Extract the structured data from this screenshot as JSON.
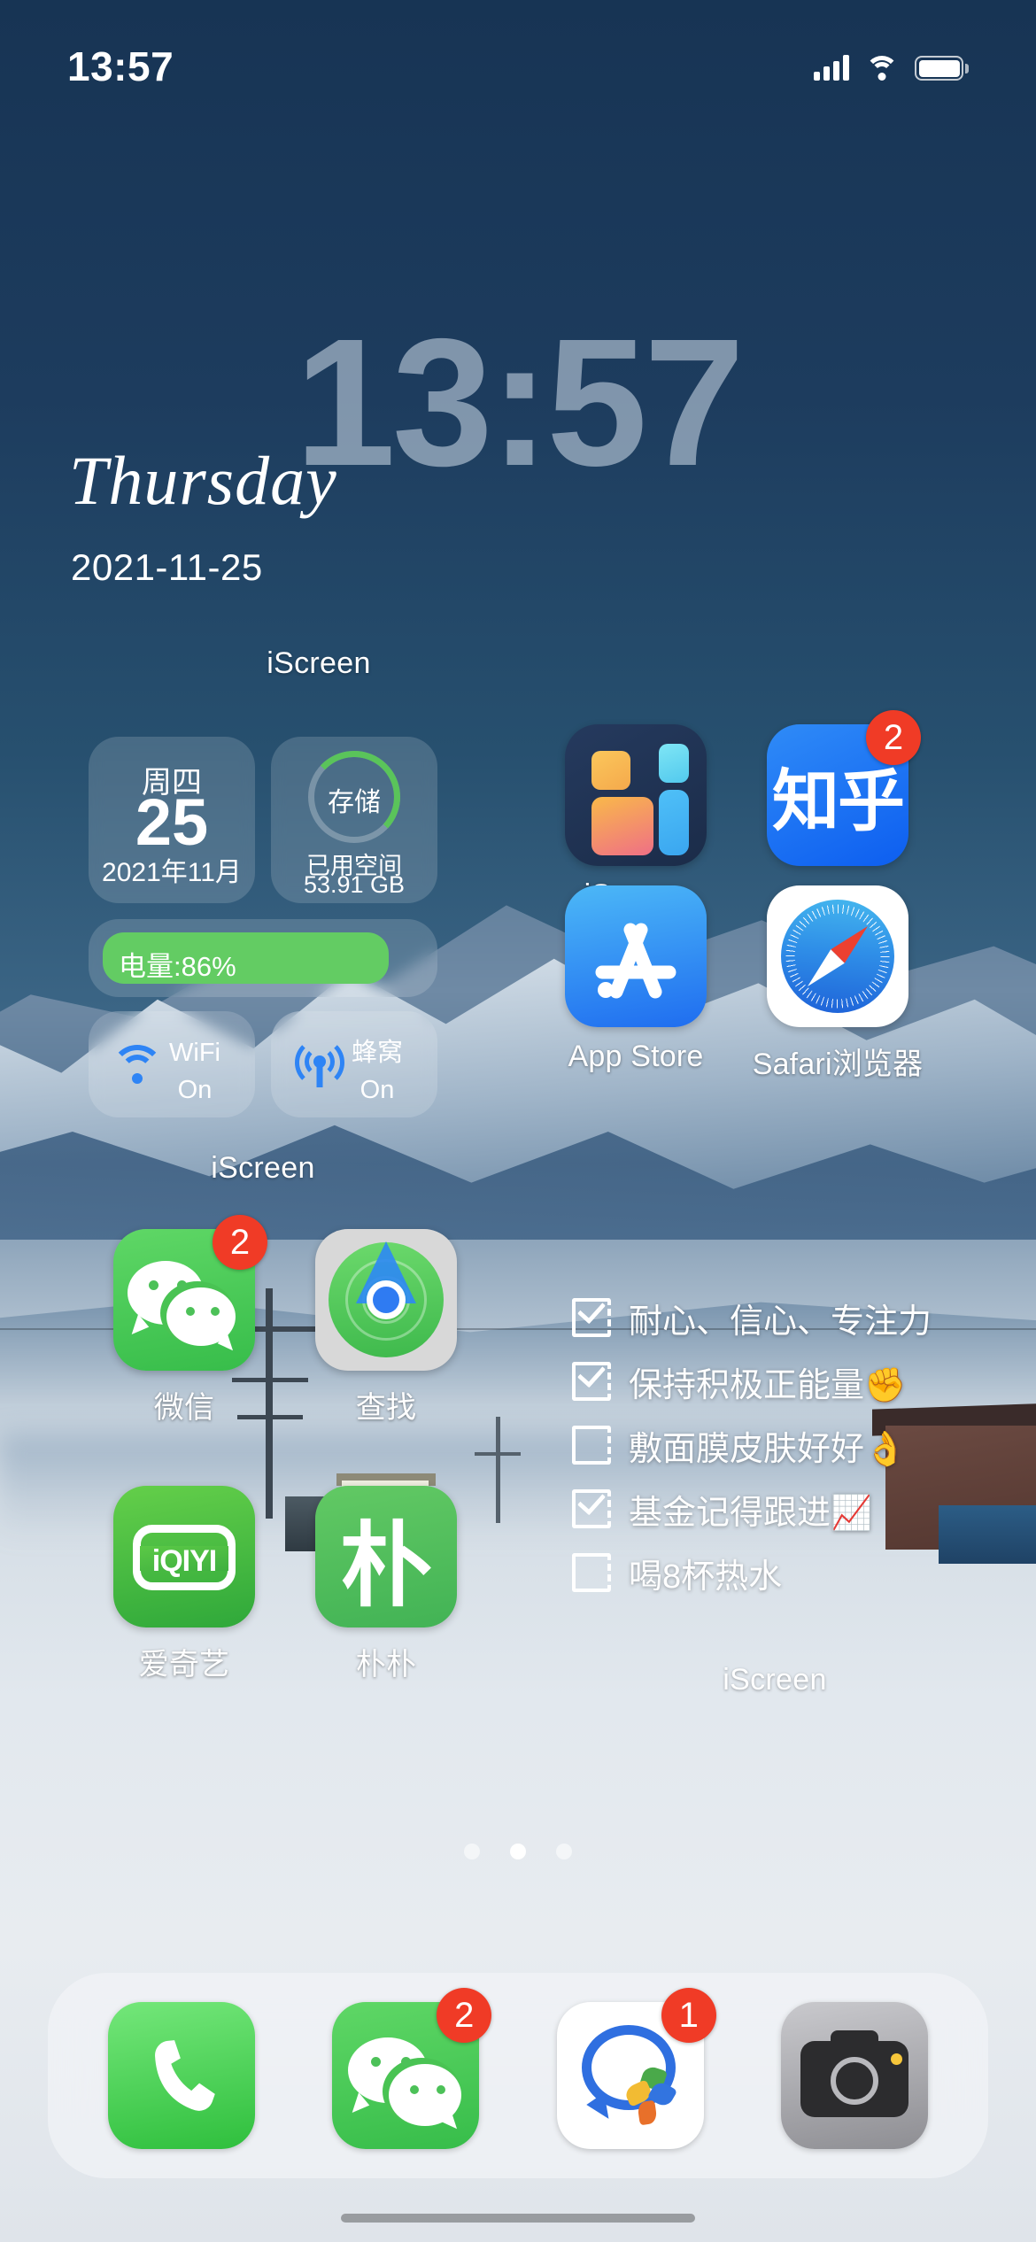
{
  "status_bar": {
    "time": "13:57",
    "cellular_icon": "signal-bars-icon",
    "wifi_icon": "wifi-icon",
    "battery_icon": "battery-icon"
  },
  "clock_widget": {
    "time": "13:57",
    "weekday": "Thursday",
    "date": "2021-11-25"
  },
  "widget_titles": {
    "top": "iScreen",
    "left": "iScreen",
    "checklist": "iScreen"
  },
  "widgets": {
    "date_card": {
      "weekday_cn": "周四",
      "day": "25",
      "year_month": "2021年11月"
    },
    "storage_card": {
      "ring_label": "存储",
      "used_label": "已用空间",
      "used_value": "53.91 GB",
      "ring_color": "#5ac45a",
      "ring_percent": 5
    },
    "battery_card": {
      "text": "电量:86%",
      "percent": 86,
      "bar_color": "#63cc63"
    },
    "wifi_card": {
      "icon": "wifi-icon",
      "title": "WiFi",
      "state": "On",
      "icon_color": "#2e84f5"
    },
    "cellular_card": {
      "icon": "cellular-antenna-icon",
      "title": "蜂窝",
      "state": "On",
      "icon_color": "#2e84f5"
    }
  },
  "checklist": {
    "items": [
      {
        "text": "耐心、信心、专注力",
        "checked": true
      },
      {
        "text": "保持积极正能量✊",
        "checked": true
      },
      {
        "text": "敷面膜皮肤好好👌",
        "checked": false
      },
      {
        "text": "基金记得跟进📈",
        "checked": true
      },
      {
        "text": "喝8杯热水",
        "checked": false
      }
    ]
  },
  "apps": [
    {
      "name": "iScreen",
      "icon": "iscreen-icon",
      "badge": null
    },
    {
      "name": "知乎",
      "icon": "zhihu-icon",
      "badge": "2",
      "glyph": "知乎"
    },
    {
      "name": "App Store",
      "icon": "appstore-icon",
      "badge": null
    },
    {
      "name": "Safari浏览器",
      "icon": "safari-icon",
      "badge": null
    },
    {
      "name": "微信",
      "icon": "wechat-icon",
      "badge": "2"
    },
    {
      "name": "查找",
      "icon": "findmy-icon",
      "badge": null
    },
    {
      "name": "爱奇艺",
      "icon": "iqiyi-icon",
      "badge": null,
      "glyph": "iQIYI"
    },
    {
      "name": "朴朴",
      "icon": "pupu-icon",
      "badge": null,
      "glyph": "朴"
    }
  ],
  "dock": [
    {
      "name": "电话",
      "icon": "phone-icon",
      "badge": null
    },
    {
      "name": "微信",
      "icon": "wechat-icon",
      "badge": "2"
    },
    {
      "name": "QQ",
      "icon": "qq-icon",
      "badge": "1"
    },
    {
      "name": "相机",
      "icon": "camera-icon",
      "badge": null
    }
  ],
  "page_dots": {
    "count": 3,
    "active_index": 1
  },
  "colors": {
    "accent_green": "#5ac45a",
    "badge_red": "#f03b26",
    "blue": "#2e84f5",
    "wallpaper_sky": "#1d3a5c"
  }
}
